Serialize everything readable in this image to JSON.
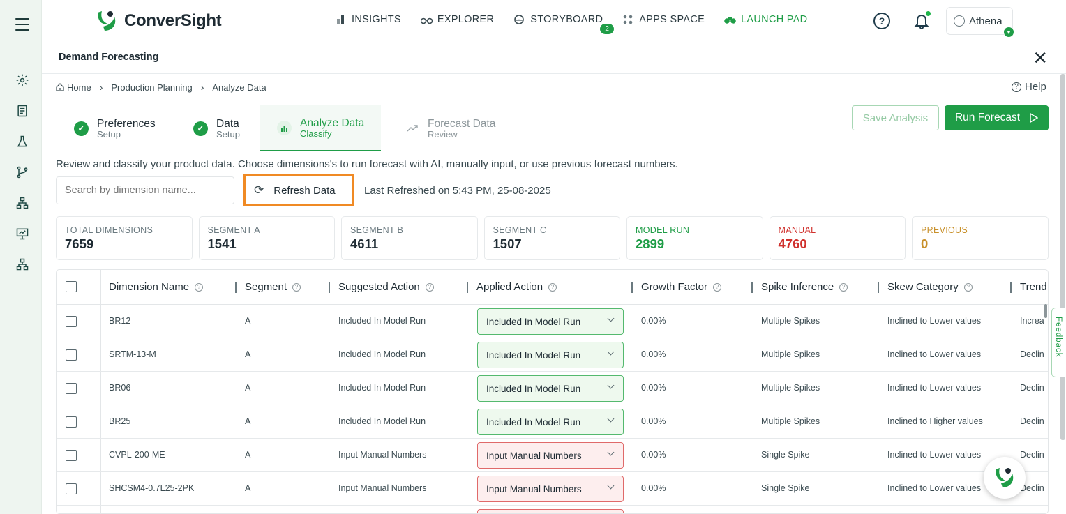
{
  "app": {
    "brand": "ConverSight",
    "colors": {
      "accent": "#1f9d47",
      "highlight": "#f08a24",
      "manual": "#d0312d",
      "previous": "#c8902a"
    }
  },
  "rail": {
    "icons": [
      "menu-icon",
      "gear-icon",
      "report-icon",
      "flask-icon",
      "branch-icon",
      "hierarchy-icon",
      "presentation-icon",
      "sitemap-icon"
    ]
  },
  "nav": {
    "items": [
      {
        "label": "INSIGHTS",
        "icon": "bar-chart-icon"
      },
      {
        "label": "EXPLORER",
        "icon": "binoculars-icon"
      },
      {
        "label": "STORYBOARD",
        "icon": "storyboard-icon",
        "badge": "2"
      },
      {
        "label": "APPS SPACE",
        "icon": "apps-grid-icon"
      },
      {
        "label": "LAUNCH PAD",
        "icon": "launchpad-icon"
      }
    ],
    "help": "?",
    "user": "Athena"
  },
  "page": {
    "title": "Demand Forecasting",
    "close": "✕",
    "breadcrumb": [
      "Home",
      "Production Planning",
      "Analyze Data"
    ],
    "help_link": "Help"
  },
  "steps": [
    {
      "title": "Preferences",
      "sub": "Setup",
      "state": "done"
    },
    {
      "title": "Data",
      "sub": "Setup",
      "state": "done"
    },
    {
      "title": "Analyze Data",
      "sub": "Classify",
      "state": "current"
    },
    {
      "title": "Forecast Data",
      "sub": "Review",
      "state": "todo"
    }
  ],
  "actions": {
    "save": "Save Analysis",
    "run": "Run Forecast"
  },
  "description": "Review and classify your product data. Choose dimensions's to run forecast with AI, manually input, or use previous forecast numbers.",
  "search": {
    "placeholder": "Search by dimension name..."
  },
  "refresh": {
    "label": "Refresh Data",
    "last": "Last Refreshed on 5:43 PM, 25-08-2025"
  },
  "stats": [
    {
      "label": "TOTAL DIMENSIONS",
      "value": "7659"
    },
    {
      "label": "SEGMENT A",
      "value": "1541"
    },
    {
      "label": "SEGMENT B",
      "value": "4611"
    },
    {
      "label": "SEGMENT C",
      "value": "1507"
    },
    {
      "label": "MODEL RUN",
      "value": "2899"
    },
    {
      "label": "MANUAL",
      "value": "4760"
    },
    {
      "label": "PREVIOUS",
      "value": "0"
    }
  ],
  "table": {
    "headers": [
      "Dimension Name",
      "Segment",
      "Suggested Action",
      "Applied Action",
      "Growth Factor",
      "Spike Inference",
      "Skew Category",
      "Trend"
    ],
    "rows": [
      {
        "name": "BR12",
        "segment": "A",
        "suggested": "Included In Model Run",
        "applied": "Included In Model Run",
        "growth": "0.00%",
        "spike": "Multiple Spikes",
        "skew": "Inclined to Lower values",
        "trend": "Increa"
      },
      {
        "name": "SRTM-13-M",
        "segment": "A",
        "suggested": "Included In Model Run",
        "applied": "Included In Model Run",
        "growth": "0.00%",
        "spike": "Multiple Spikes",
        "skew": "Inclined to Lower values",
        "trend": "Declin"
      },
      {
        "name": "BR06",
        "segment": "A",
        "suggested": "Included In Model Run",
        "applied": "Included In Model Run",
        "growth": "0.00%",
        "spike": "Multiple Spikes",
        "skew": "Inclined to Lower values",
        "trend": "Declin"
      },
      {
        "name": "BR25",
        "segment": "A",
        "suggested": "Included In Model Run",
        "applied": "Included In Model Run",
        "growth": "0.00%",
        "spike": "Multiple Spikes",
        "skew": "Inclined to Higher values",
        "trend": "Declin"
      },
      {
        "name": "CVPL-200-ME",
        "segment": "A",
        "suggested": "Input Manual Numbers",
        "applied": "Input Manual Numbers",
        "growth": "0.00%",
        "spike": "Single Spike",
        "skew": "Inclined to Lower values",
        "trend": "Declin"
      },
      {
        "name": "SHCSM4-0.7L25-2PK",
        "segment": "A",
        "suggested": "Input Manual Numbers",
        "applied": "Input Manual Numbers",
        "growth": "0.00%",
        "spike": "Single Spike",
        "skew": "Inclined to Lower values",
        "trend": "Declin"
      }
    ]
  },
  "feedback": "Feedback"
}
